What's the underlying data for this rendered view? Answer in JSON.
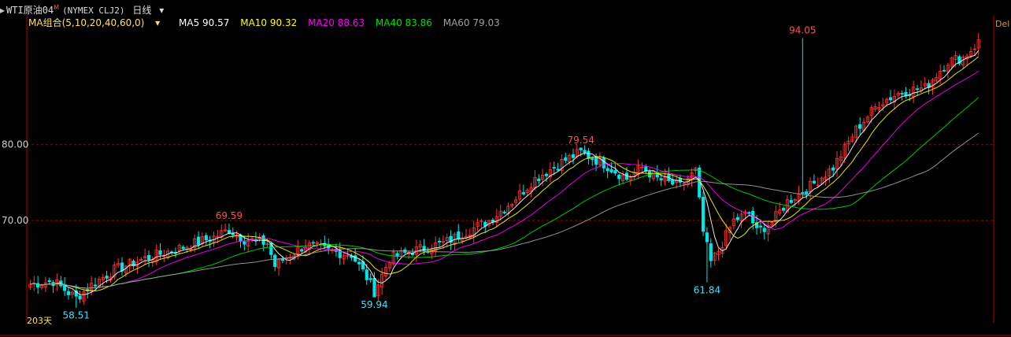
{
  "header": {
    "prefix": "▸",
    "symbol": "WTI原油04",
    "symbol_sup": "M",
    "contract": "(NYMEX CLJ2)",
    "period": "日线",
    "period_icon": "chevron-down-icon",
    "right_cut": "Del"
  },
  "ma_legend": {
    "title": "MA组合(5,10,20,40,60,0)",
    "items": [
      {
        "label": "MA5 90.57",
        "color": "#ffffff"
      },
      {
        "label": "MA10 90.32",
        "color": "#ffff00"
      },
      {
        "label": "MA20 88.63",
        "color": "#ff00ff"
      },
      {
        "label": "MA40 83.86",
        "color": "#00e000"
      },
      {
        "label": "MA60 79.03",
        "color": "#a0a0a0"
      }
    ]
  },
  "colors": {
    "up": "#ff3232",
    "down": "#00e5e5",
    "grid": "#b00000",
    "axis_text": "#cccccc"
  },
  "chart_data": {
    "type": "candlestick",
    "y_ticks": [
      80.0,
      70.0
    ],
    "y_tick_labels": [
      "80.00",
      "70.00"
    ],
    "ylim": [
      56.5,
      97
    ],
    "periods_label": "203天",
    "annotations": [
      {
        "label": "58.51",
        "value": 58.51,
        "index": 12,
        "kind": "low"
      },
      {
        "label": "69.59",
        "value": 69.59,
        "index": 52,
        "kind": "high"
      },
      {
        "label": "59.94",
        "value": 59.94,
        "index": 90,
        "kind": "low"
      },
      {
        "label": "79.54",
        "value": 79.54,
        "index": 144,
        "kind": "high"
      },
      {
        "label": "61.84",
        "value": 61.84,
        "index": 177,
        "kind": "low"
      },
      {
        "label": "94.05",
        "value": 94.05,
        "index": 202,
        "kind": "high"
      }
    ],
    "anchors": [
      [
        0,
        61.6
      ],
      [
        6,
        62.0
      ],
      [
        10,
        60.5
      ],
      [
        12,
        59.8
      ],
      [
        16,
        61.5
      ],
      [
        22,
        63.5
      ],
      [
        30,
        65.0
      ],
      [
        40,
        66.5
      ],
      [
        48,
        67.8
      ],
      [
        52,
        68.8
      ],
      [
        56,
        67.5
      ],
      [
        62,
        67.0
      ],
      [
        64,
        64.0
      ],
      [
        66,
        64.8
      ],
      [
        72,
        66.8
      ],
      [
        78,
        66.0
      ],
      [
        84,
        65.5
      ],
      [
        88,
        62.5
      ],
      [
        90,
        60.6
      ],
      [
        94,
        65.0
      ],
      [
        100,
        66.0
      ],
      [
        108,
        67.0
      ],
      [
        114,
        68.5
      ],
      [
        120,
        70.0
      ],
      [
        126,
        72.5
      ],
      [
        132,
        75.5
      ],
      [
        140,
        78.0
      ],
      [
        144,
        79.0
      ],
      [
        150,
        77.5
      ],
      [
        156,
        75.5
      ],
      [
        160,
        77.0
      ],
      [
        164,
        75.5
      ],
      [
        170,
        74.5
      ],
      [
        174,
        76.5
      ],
      [
        176,
        68.5
      ],
      [
        178,
        64.5
      ],
      [
        180,
        66.0
      ],
      [
        184,
        70.0
      ],
      [
        188,
        71.0
      ],
      [
        190,
        68.5
      ],
      [
        194,
        69.8
      ],
      [
        198,
        72.5
      ],
      [
        204,
        74.5
      ],
      [
        210,
        77.0
      ],
      [
        216,
        82.0
      ],
      [
        222,
        85.5
      ],
      [
        228,
        87.0
      ],
      [
        234,
        87.5
      ],
      [
        240,
        91.0
      ],
      [
        244,
        91.5
      ],
      [
        248,
        93.5
      ]
    ],
    "moving_averages": [
      {
        "name": "MA5",
        "period": 5,
        "value": 90.57
      },
      {
        "name": "MA10",
        "period": 10,
        "value": 90.32
      },
      {
        "name": "MA20",
        "period": 20,
        "value": 88.63
      },
      {
        "name": "MA40",
        "period": 40,
        "value": 83.86
      },
      {
        "name": "MA60",
        "period": 60,
        "value": 79.03
      }
    ]
  }
}
